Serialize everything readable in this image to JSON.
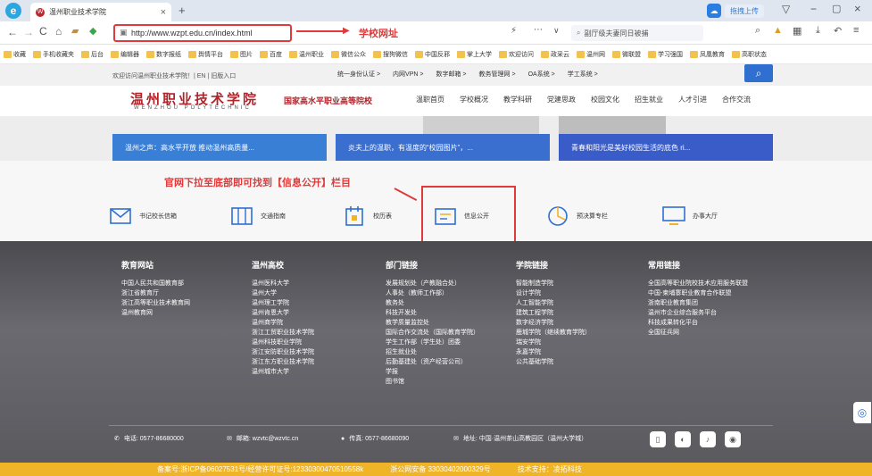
{
  "browser": {
    "tab_title": "温州职业技术学院",
    "tab_close": "×",
    "new_tab": "+",
    "url": "http://www.wzpt.edu.cn/index.html",
    "search_text": "副厅级夫妻同日被捕",
    "upload_btn": "拖拽上传",
    "annotation_url": "学校网址",
    "bookmarks": [
      "收藏",
      "手机收藏夹",
      "后台",
      "编辑器",
      "数字报纸",
      "舆情平台",
      "图片",
      "百度",
      "温州职业",
      "微信公众",
      "搜狗微信",
      "中国反邪",
      "掌上大学",
      "欢迎访问",
      "政采云",
      "温州网",
      "微联盟",
      "学习强国",
      "凤凰教育",
      "高职状态"
    ]
  },
  "site": {
    "top_welcome": "欢迎访问温州职业技术学院！| EN | 旧版入口",
    "top_links": [
      "统一身份认证 >",
      "内网VPN >",
      "数字邮箱 >",
      "教务管理网 >",
      "OA系统 >",
      "学工系统 >"
    ],
    "logo_cn": "温州职业技术学院",
    "logo_en": "WENZHOU POLYTECHNIC",
    "slogan": "国家高水平职业高等院校",
    "nav": [
      "温职首页",
      "学校概况",
      "教学科研",
      "党建思政",
      "校园文化",
      "招生就业",
      "人才引进",
      "合作交流"
    ],
    "banner_cards": [
      "温州之声：高水平开放 推动温州高质量...",
      "炎夫上的温职，有温度的“校园图片”，...",
      "青春和阳光是美好校园生活的底色 ri..."
    ],
    "annotation_mid": "官网下拉至底部即可找到【信息公开】栏目",
    "quick_links": [
      "书记校长信箱",
      "交通指南",
      "校历表",
      "信息公开",
      "预决算专栏",
      "办事大厅"
    ],
    "footer_cols": [
      {
        "title": "教育网站",
        "items": [
          "中国人民共和国教育部",
          "浙江省教育厅",
          "浙江高等职业技术教育网",
          "温州教育网"
        ]
      },
      {
        "title": "温州高校",
        "items": [
          "温州医科大学",
          "温州大学",
          "温州理工学院",
          "温州肯恩大学",
          "温州商学院",
          "浙江工贸职业技术学院",
          "温州科技职业学院",
          "浙江安防职业技术学院",
          "浙江东方职业技术学院",
          "温州城市大学"
        ]
      },
      {
        "title": "部门链接",
        "items": [
          "发展规划处（产教融合处）",
          "人事处（教师工作部）",
          "教务处",
          "科技开发处",
          "教学质量监控处",
          "国际合作交流处（国际教育学院）",
          "学生工作部（学生处）团委",
          "招生就业处",
          "后勤基建处（资产经营公司）",
          "学报",
          "图书馆"
        ]
      },
      {
        "title": "学院链接",
        "items": [
          "智能制造学院",
          "设计学院",
          "人工智能学院",
          "建筑工程学院",
          "数字经济学院",
          "鹿城学院（继续教育学院）",
          "瑞安学院",
          "永嘉学院",
          "公共基础学院"
        ]
      },
      {
        "title": "常用链接",
        "items": [
          "全国高等职业院校技术应用服务联盟",
          "中国-柬埔寨职业教育合作联盟",
          "浙南职业教育集团",
          "温州市企业综合服务平台",
          "科技成果转化平台",
          "全国征兵网"
        ]
      }
    ],
    "contact": [
      "电话: 0577-86680000",
      "邮箱: wzvtc@wzvtc.cn",
      "传真: 0577-86680090",
      "地址: 中国·温州茶山高教园区（温州大学城）"
    ],
    "bottom": [
      "备案号:浙ICP备06027531号/经营许可证号:12330300470510558k",
      "浙公网安备 33030402000329号",
      "技术支持：凌拓科技"
    ]
  },
  "colors": {
    "accent_red": "#e03a3a",
    "brand_red": "#b2232a",
    "footer_bar": "#f0b429",
    "banner_blue": "#2f6fd0"
  }
}
